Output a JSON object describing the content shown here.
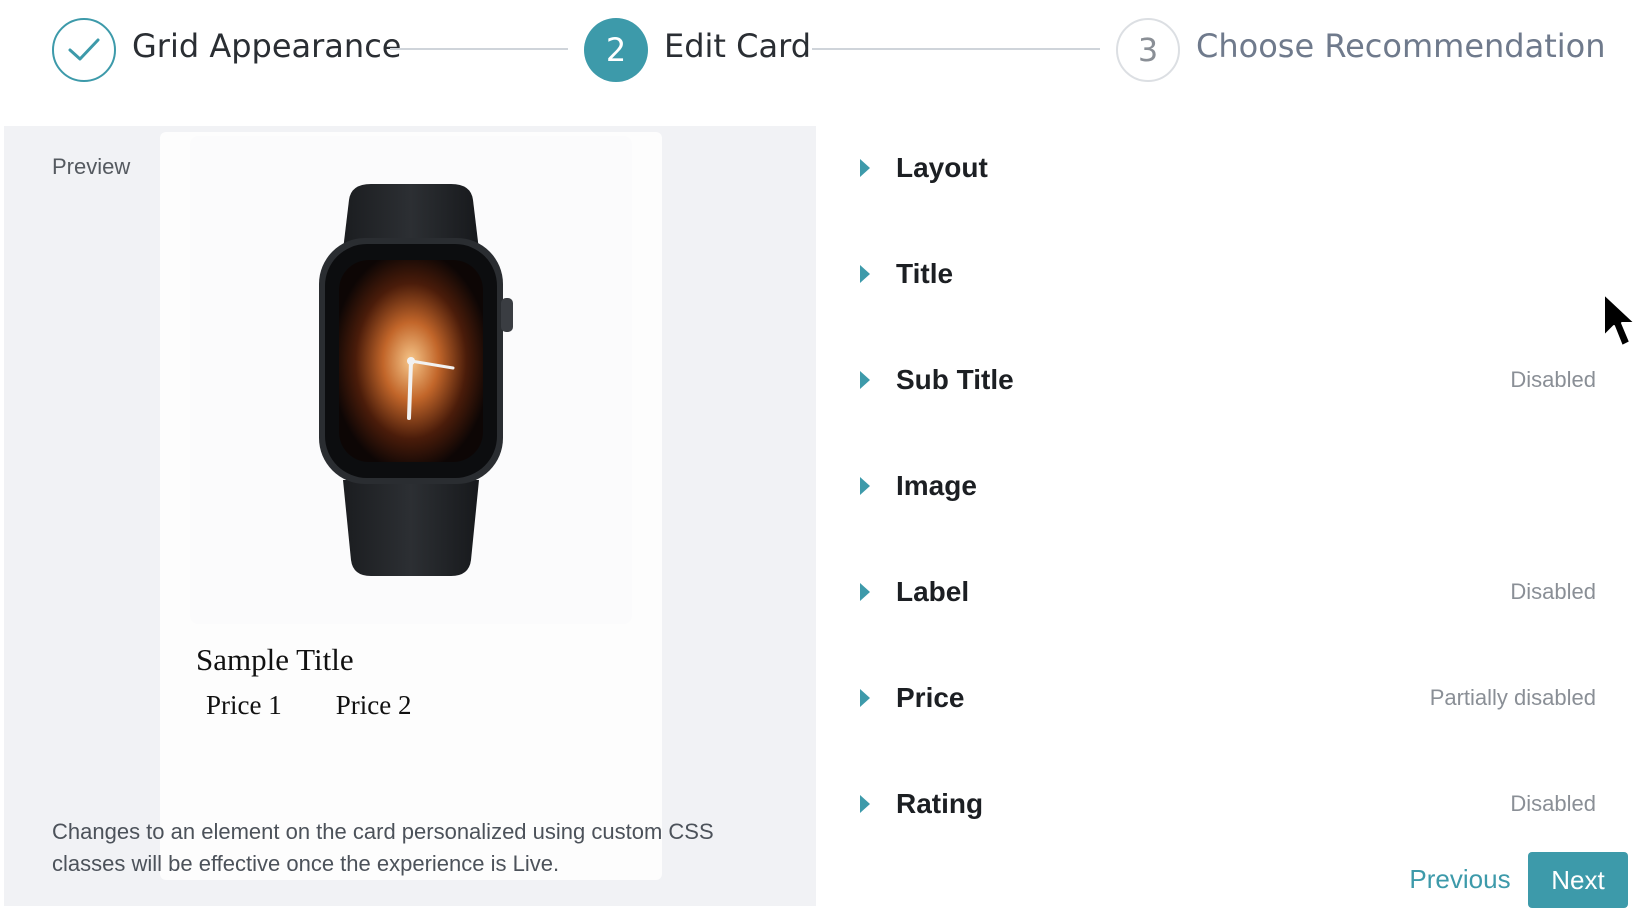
{
  "stepper": {
    "steps": [
      {
        "number": "✓",
        "label": "Grid Appearance",
        "state": "done"
      },
      {
        "number": "2",
        "label": "Edit Card",
        "state": "active"
      },
      {
        "number": "3",
        "label": "Choose Recommendation",
        "state": "todo"
      }
    ]
  },
  "preview": {
    "label": "Preview",
    "card": {
      "title": "Sample Title",
      "price1": "Price 1",
      "price2": "Price 2"
    },
    "note": "Changes to an element on the card personalized using custom CSS classes will be effective once the experience is Live."
  },
  "settings": {
    "items": [
      {
        "name": "Layout",
        "status": ""
      },
      {
        "name": "Title",
        "status": ""
      },
      {
        "name": "Sub Title",
        "status": "Disabled"
      },
      {
        "name": "Image",
        "status": ""
      },
      {
        "name": "Label",
        "status": "Disabled"
      },
      {
        "name": "Price",
        "status": "Partially disabled"
      },
      {
        "name": "Rating",
        "status": "Disabled"
      }
    ]
  },
  "footer": {
    "previous_label": "Previous",
    "next_label": "Next"
  },
  "colors": {
    "accent": "#3d9aaa"
  }
}
